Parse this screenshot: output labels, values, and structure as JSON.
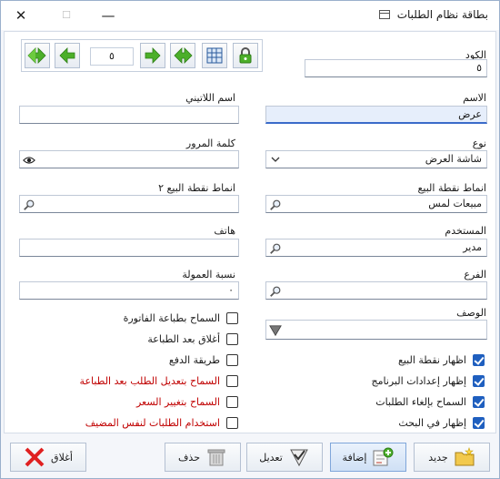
{
  "window": {
    "title": "بطاقة نظام الطلبات"
  },
  "nav": {
    "record_number": "٥"
  },
  "fields": {
    "code": {
      "label": "الكود",
      "value": "٥"
    },
    "name": {
      "label": "الاسم",
      "value": "عرض"
    },
    "latin_name": {
      "label": "اسم اللاتيني",
      "value": ""
    },
    "type": {
      "label": "نوع",
      "value": "شاشة العرض"
    },
    "password": {
      "label": "كلمة المرور",
      "value": ""
    },
    "pos_pattern": {
      "label": "انماط نقطة البيع",
      "value": "مبيعات لمس"
    },
    "pos_pattern2": {
      "label": "انماط نقطة البيع ٢",
      "value": ""
    },
    "user": {
      "label": "المستخدم",
      "value": "مدير"
    },
    "phone": {
      "label": "هاتف",
      "value": ""
    },
    "branch": {
      "label": "الفرع",
      "value": ""
    },
    "commission": {
      "label": "نسبة العمولة",
      "value": "٠"
    },
    "description": {
      "label": "الوصف",
      "value": ""
    }
  },
  "checkboxes_right": [
    {
      "label": "اظهار نقطة البيع",
      "checked": true
    },
    {
      "label": "إظهار إعدادات البرنامج",
      "checked": true
    },
    {
      "label": "السماح بإلغاء الطلبات",
      "checked": true
    },
    {
      "label": "إظهار في البحث",
      "checked": true
    }
  ],
  "checkboxes_left": [
    {
      "label": "السماح بطباعة الفاتورة",
      "checked": false,
      "red": false
    },
    {
      "label": "أغلاق بعد الطباعة",
      "checked": false,
      "red": false
    },
    {
      "label": "طريقة الدفع",
      "checked": false,
      "red": false
    },
    {
      "label": "السماح بتعديل الطلب بعد الطباعة",
      "checked": false,
      "red": true
    },
    {
      "label": "السماح بتغيير السعر",
      "checked": false,
      "red": true
    },
    {
      "label": "استخدام الطلبات لنفس المضيف",
      "checked": false,
      "red": true
    }
  ],
  "buttons": {
    "new": "جديد",
    "add": "إضافة",
    "edit": "تعديل",
    "delete": "حذف",
    "close": "أغلاق"
  },
  "colors": {
    "accent": "#1f5fbf",
    "warning_text": "#c00000",
    "nav_green": "#4caf2a"
  }
}
